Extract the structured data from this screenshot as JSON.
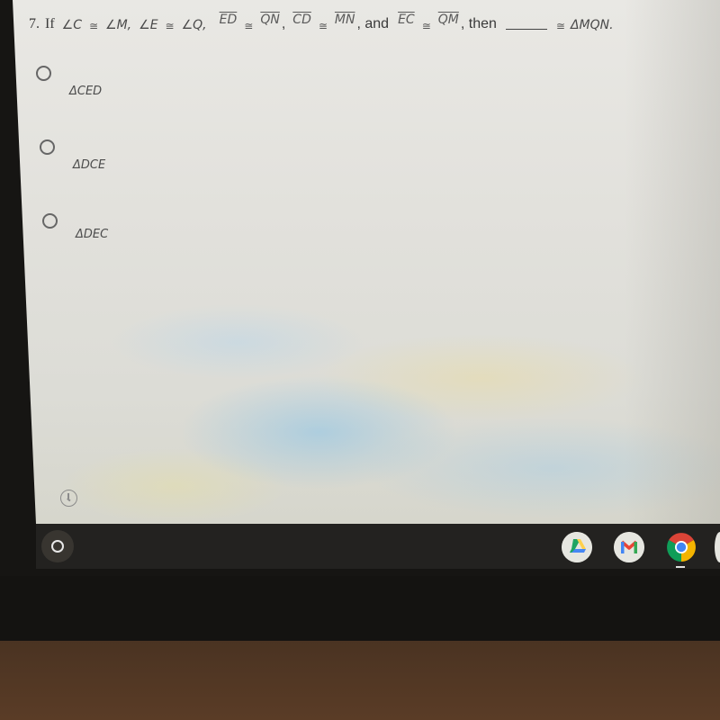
{
  "question": {
    "number": "7.",
    "if_label": "If",
    "angle1_left": "∠C",
    "angle1_right": "∠M,",
    "angle2_left": "∠E",
    "angle2_right": "∠Q,",
    "seg1_left": "ED",
    "seg1_right": "QN",
    "seg2_left": "CD",
    "seg2_right": "MN",
    "and_label": ", and",
    "seg3_left": "EC",
    "seg3_right": "QM",
    "then_label": ", then",
    "comma": ",",
    "congruent_symbol": "≅",
    "target_triangle": "ΔMQN."
  },
  "choices": [
    {
      "label": "ΔCED",
      "selected": false
    },
    {
      "label": "ΔDCE",
      "selected": false
    },
    {
      "label": "ΔDEC",
      "selected": false
    }
  ],
  "shelf": {
    "launcher_icon": "launcher-icon",
    "apps": [
      {
        "name": "Google Drive",
        "icon": "google-drive-icon",
        "running": false
      },
      {
        "name": "Gmail",
        "icon": "gmail-icon",
        "running": false
      },
      {
        "name": "Google Chrome",
        "icon": "chrome-icon",
        "running": true
      }
    ]
  },
  "colors": {
    "drive_green": "#1fa463",
    "drive_yellow": "#ffd04b",
    "drive_blue": "#4687f4",
    "gmail_red": "#ea4335",
    "gmail_blue": "#4285f4",
    "chrome_red": "#db4437",
    "chrome_green": "#0f9d58",
    "chrome_yellow": "#f4b400",
    "chrome_blue": "#4285f4"
  }
}
